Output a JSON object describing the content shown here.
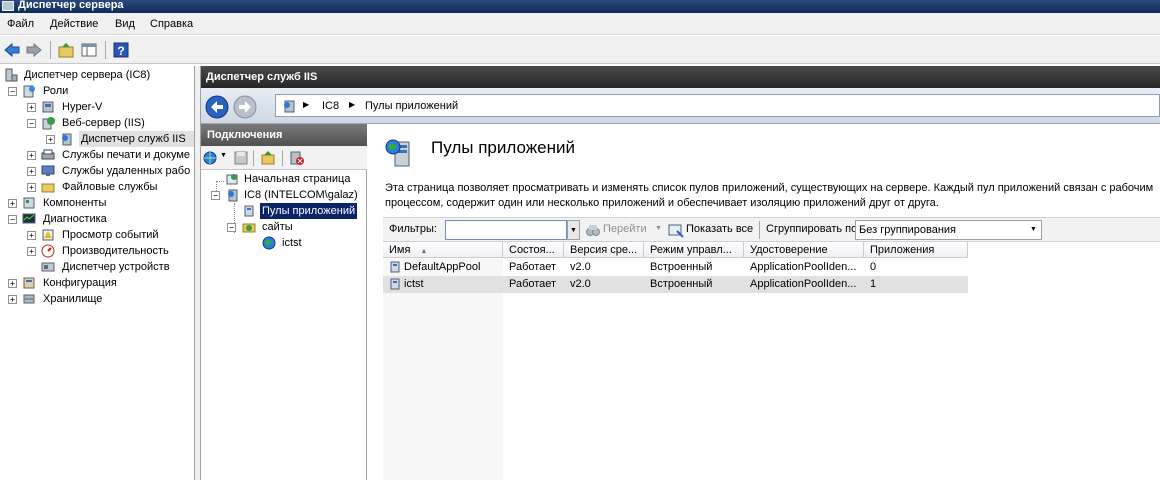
{
  "window": {
    "title": "Диспетчер сервера"
  },
  "menu": [
    "Файл",
    "Действие",
    "Вид",
    "Справка"
  ],
  "tree": {
    "root": "Диспетчер сервера (IC8)",
    "roles": "Роли",
    "hyperv": "Hyper-V",
    "webserver": "Веб-сервер (IIS)",
    "iis_manager": "Диспетчер служб IIS",
    "print": "Службы печати и докуме",
    "remote": "Службы удаленных рабо",
    "file": "Файловые службы",
    "components": "Компоненты",
    "diagnostics": "Диагностика",
    "events": "Просмотр событий",
    "perf": "Производительность",
    "devices": "Диспетчер устройств",
    "config": "Конфигурация",
    "storage": "Хранилище"
  },
  "iis": {
    "header": "Диспетчер служб IIS",
    "breadcrumb": [
      "IC8",
      "Пулы приложений"
    ],
    "connections": {
      "title": "Подключения",
      "start": "Начальная страница",
      "server": "IC8 (INTELCOM\\galaz)",
      "pools": "Пулы приложений",
      "sites": "сайты",
      "site1": "ictst"
    }
  },
  "main": {
    "title": "Пулы приложений",
    "description_line1": "Эта страница позволяет просматривать и изменять список пулов приложений, существующих на сервере. Каждый пул приложений связан с рабочим",
    "description_line2": "процессом, содержит один или несколько приложений и обеспечивает изоляцию приложений друг от друга.",
    "filter_label": "Фильтры:",
    "filter_value": "",
    "go_label": "Перейти",
    "show_all_label": "Показать все",
    "group_label": "Сгруппировать по:",
    "group_value": "Без группирования",
    "columns": [
      "Имя",
      "Состоя...",
      "Версия сре...",
      "Режим управл...",
      "Удостоверение",
      "Приложения"
    ],
    "rows": [
      [
        "DefaultAppPool",
        "Работает",
        "v2.0",
        "Встроенный",
        "ApplicationPoolIden...",
        "0"
      ],
      [
        "ictst",
        "Работает",
        "v2.0",
        "Встроенный",
        "ApplicationPoolIden...",
        "1"
      ]
    ]
  },
  "colors": {
    "selection": "#0a246a",
    "selected_row": "#e1e1e1",
    "header_dark": "#262626"
  }
}
